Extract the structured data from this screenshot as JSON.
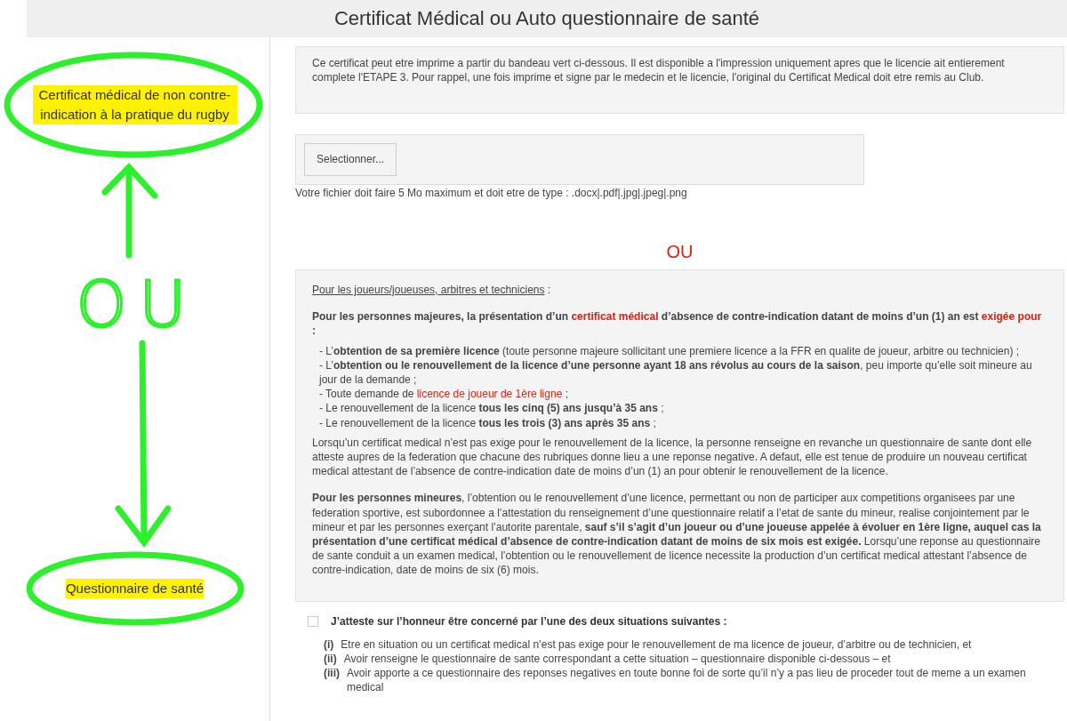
{
  "header": {
    "title": "Certificat Médical ou Auto questionnaire de santé"
  },
  "annotations": {
    "top_label": "Certificat médical de non contre-indication à la pratique du rugby",
    "handwritten": "OU",
    "bottom_label": "Questionnaire de santé"
  },
  "notice": "Ce certificat peut etre imprime a partir du bandeau vert ci-dessous. Il est disponible a l'impression uniquement apres que le licencie ait entierement complete l'ETAPE 3. Pour rappel, une fois imprime et signe par le medecin et le licencie, l'original du Certificat Medical doit etre remis au Club.",
  "upload": {
    "button": "Selectionner...",
    "hint": "Votre fichier doit faire 5 Mo maximum et doit etre de type : .docx|.pdf|.jpg|.jpeg|.png"
  },
  "separator": "OU",
  "rules": {
    "heading": "Pour les joueurs/joueuses, arbitres et techniciens",
    "heading_suffix": " :",
    "intro": [
      {
        "text": "Pour les personnes majeures, la présentation d’un ",
        "bold": true,
        "red": false
      },
      {
        "text": "certificat médical",
        "bold": true,
        "red": true
      },
      {
        "text": " d’absence de contre-indication datant de moins d’un (1) an est ",
        "bold": true,
        "red": false
      },
      {
        "text": "exigée pour",
        "bold": true,
        "red": true
      },
      {
        "text": " :",
        "bold": true,
        "red": false
      }
    ],
    "items": [
      [
        {
          "text": "- L’",
          "bold": false,
          "red": false
        },
        {
          "text": "obtention de sa première licence",
          "bold": true,
          "red": false
        },
        {
          "text": " (toute personne majeure sollicitant une premiere licence a la FFR en qualite de joueur, arbitre ou technicien) ;",
          "bold": false,
          "red": false
        }
      ],
      [
        {
          "text": "- L’",
          "bold": false,
          "red": false
        },
        {
          "text": "obtention ou le renouvellement de la licence d’une personne ayant 18 ans révolus au cours de la saison",
          "bold": true,
          "red": false
        },
        {
          "text": ", peu importe qu’elle soit mineure au jour de la demande ;",
          "bold": false,
          "red": false
        }
      ],
      [
        {
          "text": "- Toute demande de ",
          "bold": false,
          "red": false
        },
        {
          "text": "licence de joueur de 1ère ligne",
          "bold": false,
          "red": true
        },
        {
          "text": " ;",
          "bold": false,
          "red": false
        }
      ],
      [
        {
          "text": "- Le renouvellement de la licence ",
          "bold": false,
          "red": false
        },
        {
          "text": "tous les cinq (5) ans jusqu’à 35 ans",
          "bold": true,
          "red": false
        },
        {
          "text": " ;",
          "bold": false,
          "red": false
        }
      ],
      [
        {
          "text": "- Le renouvellement de la licence ",
          "bold": false,
          "red": false
        },
        {
          "text": "tous les trois (3) ans après 35 ans",
          "bold": true,
          "red": false
        },
        {
          "text": " ;",
          "bold": false,
          "red": false
        }
      ]
    ],
    "paragraphs": [
      [
        {
          "text": "Lorsqu’un certificat medical n’est pas exige pour le renouvellement de la licence, la personne renseigne en revanche un questionnaire de sante dont elle atteste aupres de la federation que chacune des rubriques donne lieu a une reponse negative. A defaut, elle est tenue de produire un nouveau certificat medical attestant de l’absence de contre-indication date de moins d’un (1) an pour obtenir le renouvellement de la licence.",
          "bold": false,
          "red": false
        }
      ],
      [
        {
          "text": "Pour les personnes mineures",
          "bold": true,
          "red": false
        },
        {
          "text": ", l’obtention ou le renouvellement d’une licence, permettant ou non de participer aux competitions organisees par une federation sportive, est subordonnee a l’attestation du renseignement d’une questionnaire relatif a l’etat de sante du mineur, realise conjointement par le mineur et par les personnes exerçant l’autorite parentale, ",
          "bold": false,
          "red": false
        },
        {
          "text": "sauf s’il s’agit d’un joueur ou d’une joueuse appelée à évoluer en 1ère ligne, auquel cas la présentation d’une certificat médical d’absence de contre-indication datant de moins de six mois est exigée.",
          "bold": true,
          "red": false
        },
        {
          "text": " Lorsqu’une reponse au questionnaire de sante conduit a un examen medical, l’obtention ou le renouvellement de licence necessite la production d’un certificat medical attestant l’absence de contre-indication, date de moins de six (6) mois.",
          "bold": false,
          "red": false
        }
      ]
    ]
  },
  "attestation": {
    "checked": false,
    "label": "J’atteste sur l’honneur être concerné par l’une des deux situations suivantes :",
    "items": [
      {
        "marker": "(i)",
        "text": "Etre en situation ou un certificat medical n’est pas exige pour le renouvellement de ma licence de joueur, d’arbitre ou de technicien, et"
      },
      {
        "marker": "(ii)",
        "text": "Avoir renseigne le questionnaire de sante correspondant a cette situation – questionnaire disponible ci-dessous – et"
      },
      {
        "marker": "(iii)",
        "text": "Avoir apporte a ce questionnaire des reponses negatives en toute bonne foi de sorte qu’il n’y a pas lieu de proceder tout de meme a un examen medical"
      }
    ]
  }
}
